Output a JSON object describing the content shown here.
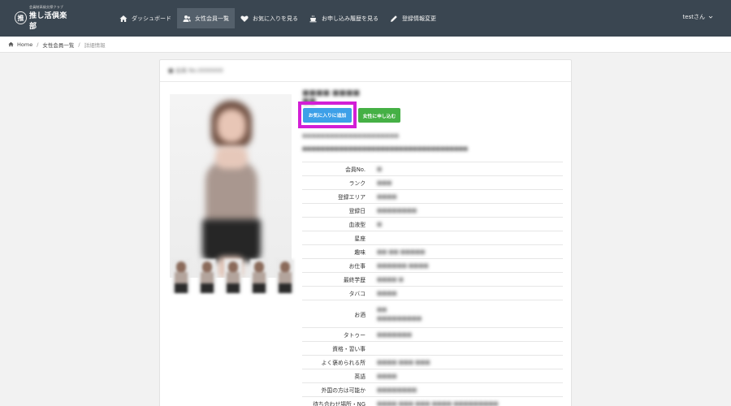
{
  "header": {
    "logo": {
      "mark": "推",
      "subtitle": "会員制高級交際クラブ",
      "title": "推し活倶楽部"
    },
    "nav": [
      {
        "label": "ダッシュボード",
        "icon": "home-icon"
      },
      {
        "label": "女性会員一覧",
        "icon": "users-icon",
        "active": true
      },
      {
        "label": "お気に入りを見る",
        "icon": "heart-icon"
      },
      {
        "label": "お申し込み履歴を見る",
        "icon": "coffee-icon"
      },
      {
        "label": "登録情報変更",
        "icon": "pencil-icon"
      }
    ],
    "user": "testさん"
  },
  "breadcrumb": {
    "home": "Home",
    "list": "女性会員一覧",
    "current": "詳細情報"
  },
  "card": {
    "title": "■ 会員 No.0000000",
    "name": "■■■■ ■■■■ ■■",
    "fav_button": "お気に入りに追加",
    "apply_button": "女性に申し込む",
    "note1": "■■■■■■■■■■■■■■■■■■■■■",
    "note2": "■■■■■■■■■■■■■■■■■■■■■■■■■■■■■■■■■■■■",
    "rows": [
      {
        "label": "会員No.",
        "value": "■"
      },
      {
        "label": "ランク",
        "value": "■■■"
      },
      {
        "label": "登録エリア",
        "value": "■■■■"
      },
      {
        "label": "登録日",
        "value": "■■■■■■■■"
      },
      {
        "label": "血液型",
        "value": "■"
      },
      {
        "label": "星座",
        "value": ""
      },
      {
        "label": "趣味",
        "value": "■■ ■■ ■■■■■"
      },
      {
        "label": "お仕事",
        "value": "■■■■■■ ■■■■"
      },
      {
        "label": "最終学歴",
        "value": "■■■■ ■"
      },
      {
        "label": "タバコ",
        "value": "■■■■"
      },
      {
        "label": "お酒",
        "value": "■■\n■■■■■■■■■",
        "tall": true
      },
      {
        "label": "タトゥー",
        "value": "■■■■■■■"
      },
      {
        "label": "資格・習い事",
        "value": ""
      },
      {
        "label": "よく褒められる所",
        "value": "■■■■ ■■■ ■■■"
      },
      {
        "label": "英語",
        "value": "■■■■"
      },
      {
        "label": "外国の方は可能か",
        "value": "■■■■■■■■"
      },
      {
        "label": "待ち合わせ場所・NG",
        "value": "■■■■ ■■■ ■■■ ■■■■ ■■■■■■■■■"
      }
    ]
  },
  "colors": {
    "header_bg": "#3a4651",
    "nav_active": "#54606b",
    "fav": "#3da0e8",
    "apply": "#45b045",
    "highlight": "#d21fd6"
  }
}
